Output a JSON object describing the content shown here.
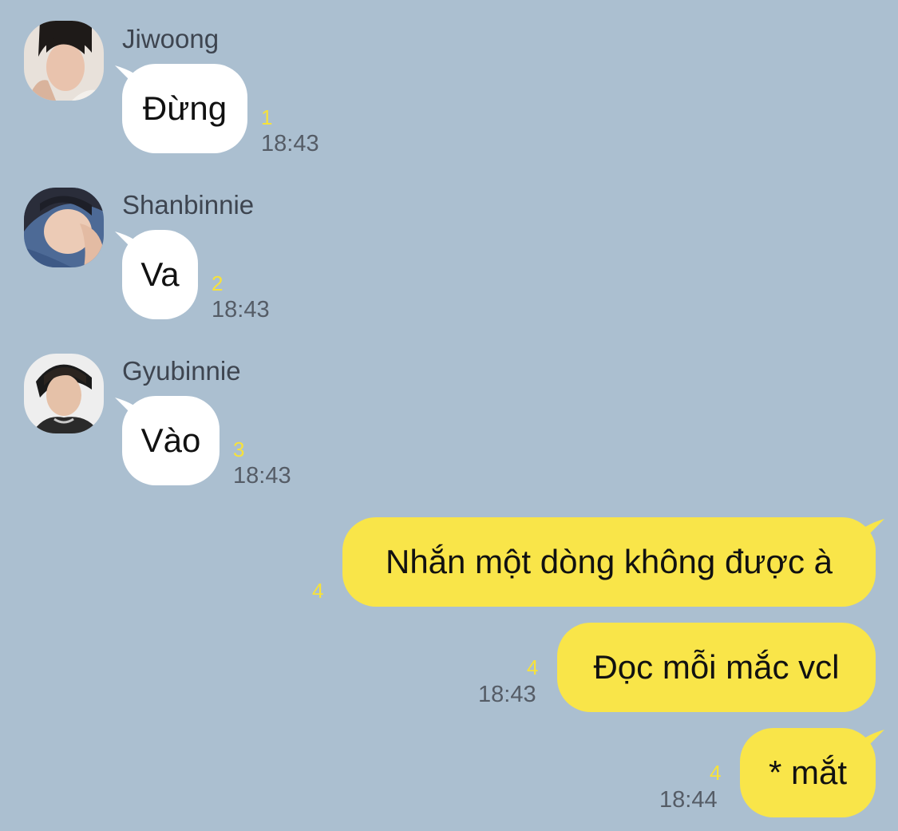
{
  "colors": {
    "background": "#abbfd0",
    "incoming_bubble": "#ffffff",
    "outgoing_bubble": "#f9e549",
    "unread_count": "#f7e23a",
    "timestamp": "#555c66",
    "sender_name": "#3e4550"
  },
  "messages": [
    {
      "sender": "Jiwoong",
      "text": "Đừng",
      "unread": "1",
      "time": "18:43",
      "avatar_icon": "user-avatar-icon"
    },
    {
      "sender": "Shanbinnie",
      "text": "Va",
      "unread": "2",
      "time": "18:43",
      "avatar_icon": "user-avatar-icon"
    },
    {
      "sender": "Gyubinnie",
      "text": "Vào",
      "unread": "3",
      "time": "18:43",
      "avatar_icon": "user-avatar-icon"
    },
    {
      "sender": "",
      "text": "Nhắn một dòng không được à",
      "unread": "4",
      "time": "",
      "outgoing": true
    },
    {
      "sender": "",
      "text": "Đọc mỗi mắc vcl",
      "unread": "4",
      "time": "18:43",
      "outgoing": true
    },
    {
      "sender": "",
      "text": "* mắt",
      "unread": "4",
      "time": "18:44",
      "outgoing": true
    }
  ]
}
